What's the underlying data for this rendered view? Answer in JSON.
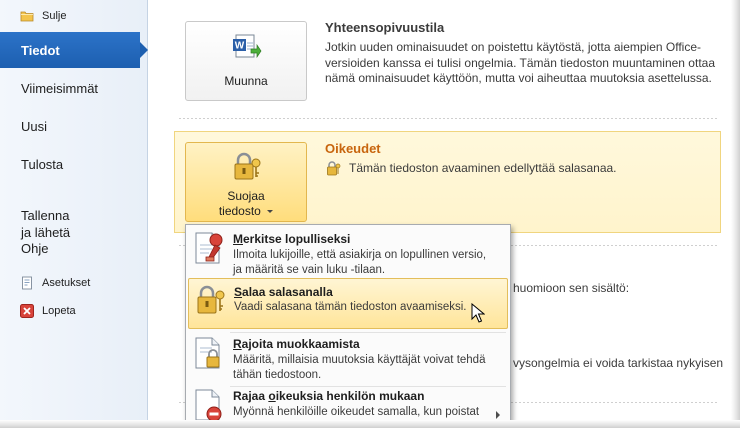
{
  "nav": {
    "close_label": "Sulje",
    "items": [
      {
        "label": "Tiedot",
        "active": true
      },
      {
        "label": "Viimeisimmät"
      },
      {
        "label": "Uusi"
      },
      {
        "label": "Tulosta"
      },
      {
        "label": "Tallenna\nja lähetä"
      },
      {
        "label": "Ohje"
      }
    ],
    "options_label": "Asetukset",
    "exit_label": "Lopeta"
  },
  "compat": {
    "button_label": "Muunna",
    "title": "Yhteensopivuustila",
    "body": "Jotkin uuden ominaisuudet on poistettu käytöstä, jotta aiempien Office-versioiden kanssa ei tulisi ongelmia. Tämän tiedoston muuntaminen ottaa nämä ominaisuudet käyttöön, mutta voi aiheuttaa muutoksia asettelussa."
  },
  "permissions": {
    "button_label_line1": "Suojaa",
    "button_label_line2": "tiedosto",
    "title": "Oikeudet",
    "status": "Tämän tiedoston avaaminen edellyttää salasanaa."
  },
  "background_fragments": {
    "inspect_line": "huomioon sen sisältö:",
    "compat_check_line": "vysongelmia ei voida tarkistaa nykyisen"
  },
  "menu": {
    "items": [
      {
        "accelerator": "M",
        "title_rest": "erkitse lopulliseksi",
        "desc": "Ilmoita lukijoille, että asiakirja on lopullinen versio, ja määritä se vain luku -tilaan.",
        "icon": "stamp-icon"
      },
      {
        "accelerator": "S",
        "title_rest": "alaa salasanalla",
        "desc": "Vaadi salasana tämän tiedoston avaamiseksi.",
        "icon": "lock-key-icon",
        "highlighted": true
      },
      {
        "accelerator": "R",
        "title_rest": "ajoita muokkaamista",
        "desc": "Määritä, millaisia muutoksia käyttäjät voivat tehdä tähän tiedostoon.",
        "icon": "document-lock-icon"
      },
      {
        "title_prefix": "Rajaa ",
        "accelerator": "o",
        "title_rest": "ikeuksia henkilön mukaan",
        "desc": "Myönnä henkilöille oikeudet samalla, kun poistat",
        "icon": "document-restrict-icon",
        "has_submenu": true
      }
    ]
  },
  "colors": {
    "nav_active": "#1d5fb0",
    "panel_highlight": "#fff4cc",
    "menu_hover": "#ffe59a"
  }
}
